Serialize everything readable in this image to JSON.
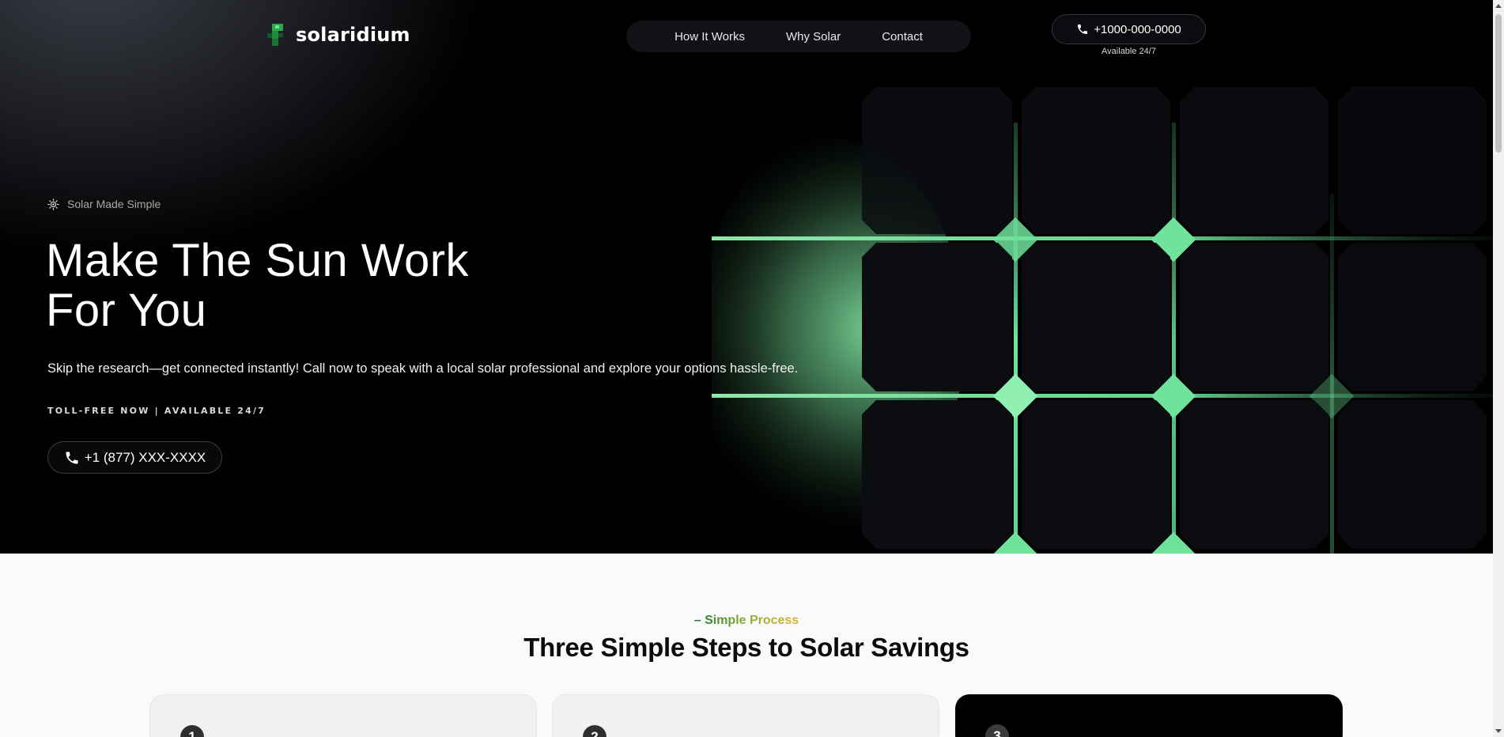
{
  "brand": {
    "name": "solaridium"
  },
  "nav": {
    "items": [
      "How It Works",
      "Why Solar",
      "Contact"
    ]
  },
  "header_phone": {
    "number": "+1000-000-0000",
    "availability": "Available 24/7"
  },
  "hero": {
    "eyebrow": "Solar Made Simple",
    "title_line1": "Make The Sun Work",
    "title_line2": "For You",
    "subtitle": "Skip the research—get connected instantly! Call now to speak with a local solar professional and explore your options hassle-free.",
    "tollfree": "TOLL-FREE NOW | AVAILABLE 24/7",
    "cta_phone": "+1 (877) XXX-XXXX"
  },
  "process": {
    "eyebrow": "– Simple Process",
    "title": "Three Simple Steps to Solar Savings",
    "steps": [
      {
        "number": "1"
      },
      {
        "number": "2"
      },
      {
        "number": "3"
      }
    ]
  },
  "colors": {
    "accent_green": "#5fd48f",
    "brand_green": "#1f8a3a",
    "hero_bg": "#000000"
  },
  "icons": {
    "phone": "phone-icon",
    "sun": "sun-icon",
    "logo": "logo-mark-icon"
  }
}
